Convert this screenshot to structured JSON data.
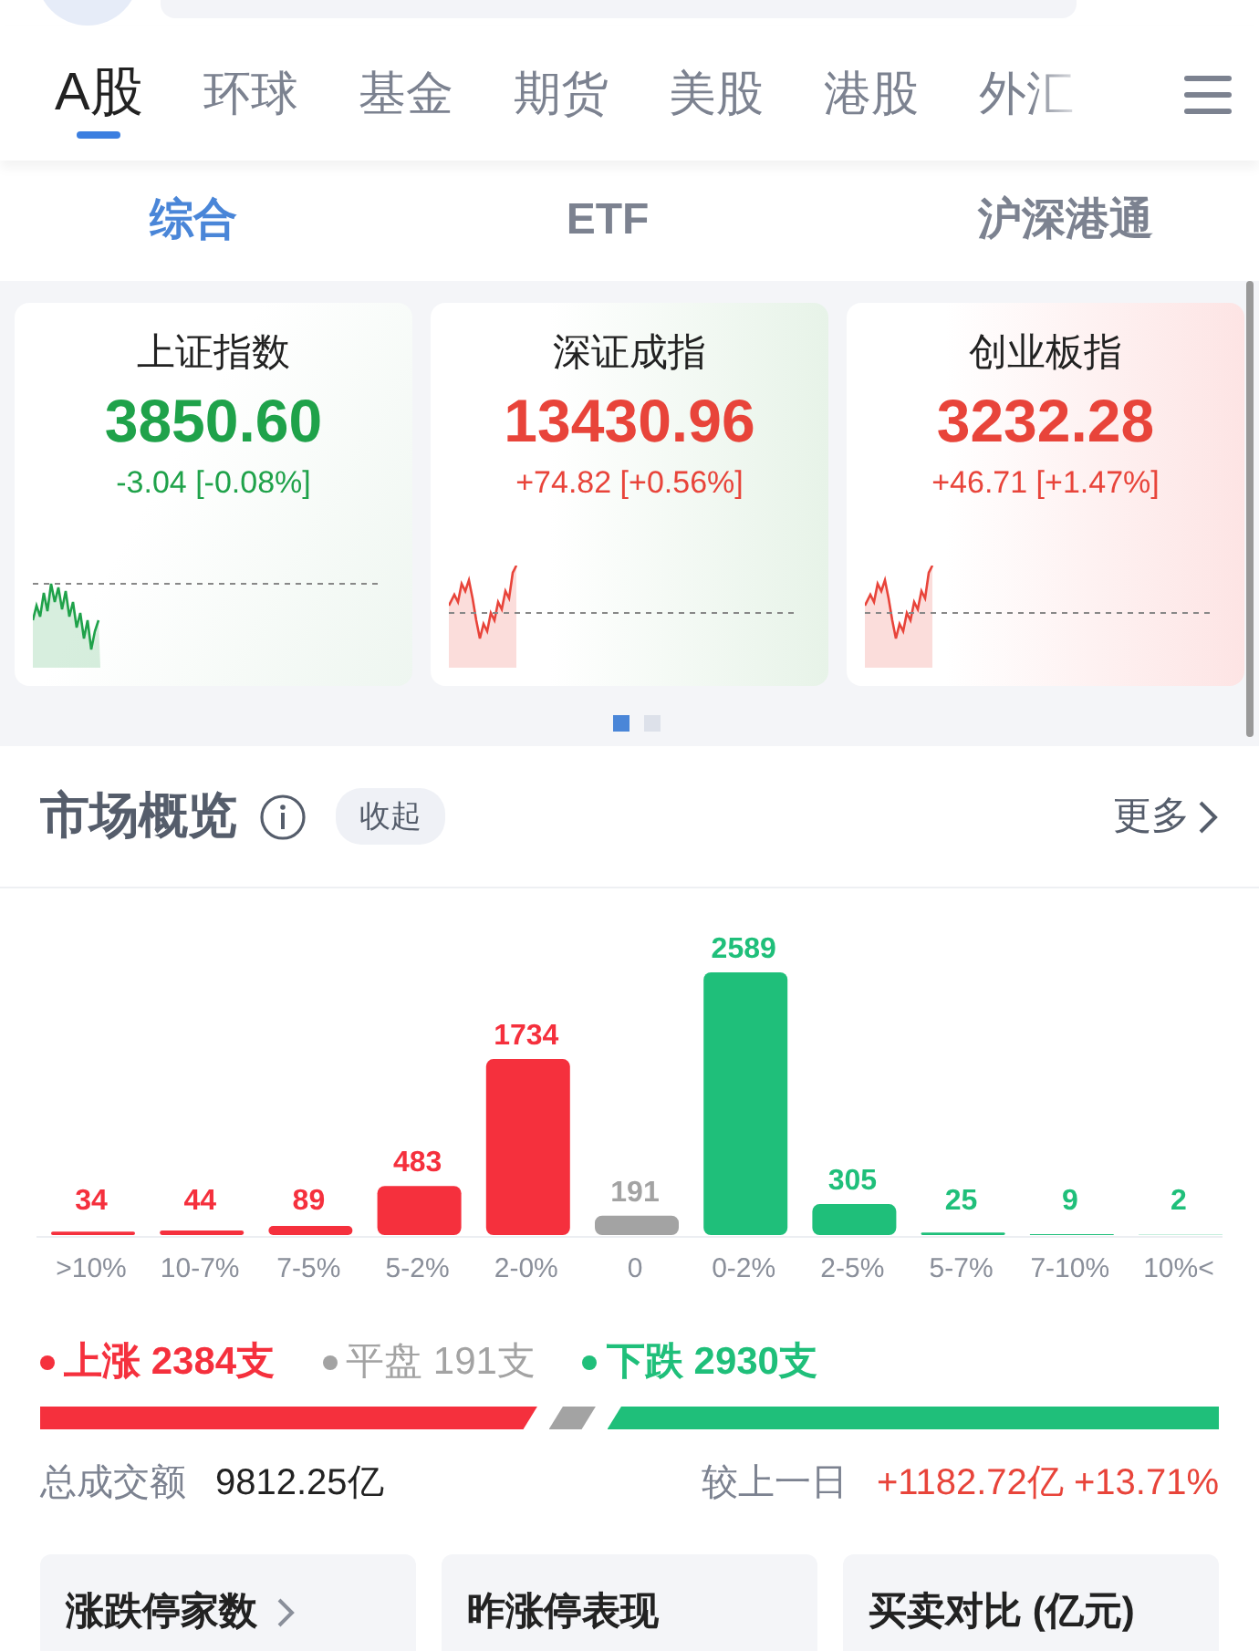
{
  "top_bar": {
    "kind": "search"
  },
  "tabs": [
    {
      "label": "A股",
      "selected": true
    },
    {
      "label": "环球",
      "selected": false
    },
    {
      "label": "基金",
      "selected": false
    },
    {
      "label": "期货",
      "selected": false
    },
    {
      "label": "美股",
      "selected": false
    },
    {
      "label": "港股",
      "selected": false
    },
    {
      "label": "外汇",
      "selected": false
    }
  ],
  "sub_tabs": [
    {
      "label": "综合",
      "selected": true
    },
    {
      "label": "ETF",
      "selected": false
    },
    {
      "label": "沪深港通",
      "selected": false
    }
  ],
  "indices": [
    {
      "name": "上证指数",
      "value": "3850.60",
      "change": "-3.04 [-0.08%]",
      "kind": "down"
    },
    {
      "name": "深证成指",
      "value": "13430.96",
      "change": "+74.82 [+0.56%]",
      "kind": "up"
    },
    {
      "name": "创业板指",
      "value": "3232.28",
      "change": "+46.71 [+1.47%]",
      "kind": "up"
    }
  ],
  "pager": [
    {
      "selected": true
    },
    {
      "selected": false
    }
  ],
  "overview": {
    "title": "市场概览",
    "collapse": "收起",
    "more": "更多",
    "chart_data": {
      "type": "bar",
      "data_labels": true,
      "categories": [
        ">10%",
        "10-7%",
        "7-5%",
        "5-2%",
        "2-0%",
        "0",
        "0-2%",
        "2-5%",
        "5-7%",
        "7-10%",
        "10%<"
      ],
      "values": [
        34,
        44,
        89,
        483,
        1734,
        191,
        2589,
        305,
        25,
        9,
        2
      ],
      "colors": [
        "#f5303d",
        "#f5303d",
        "#f5303d",
        "#f5303d",
        "#f5303d",
        "#a3a3a3",
        "#1fbf7a",
        "#1fbf7a",
        "#1fbf7a",
        "#1fbf7a",
        "#1fbf7a"
      ]
    },
    "legend": [
      {
        "label": "上涨",
        "count": "2384支",
        "color": "#f5303d"
      },
      {
        "label": "平盘",
        "count": "191支",
        "color": "#a3a3a3"
      },
      {
        "label": "下跌",
        "count": "2930支",
        "color": "#1fbf7a"
      }
    ],
    "turnover": {
      "label": "总成交额",
      "value": "9812.25亿",
      "compare_label": "较上一日",
      "compare_value": "+1182.72亿 +13.71%"
    }
  },
  "bottom_cards": [
    {
      "label": "涨跌停家数",
      "arrow": true
    },
    {
      "label": "昨涨停表现",
      "arrow": false
    },
    {
      "label": "买卖对比 (亿元)",
      "arrow": false
    }
  ]
}
